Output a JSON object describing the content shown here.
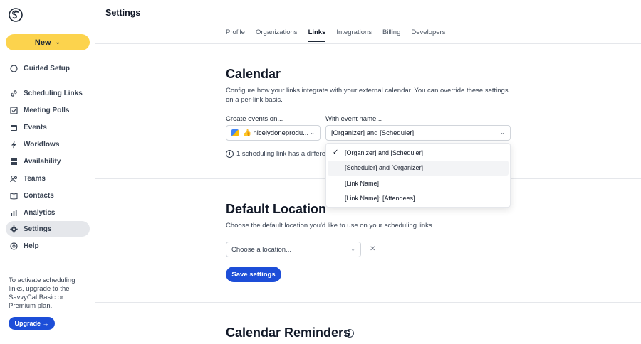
{
  "sidebar": {
    "new_label": "New",
    "items": [
      {
        "label": "Guided Setup",
        "icon": "circle-icon"
      },
      {
        "label": "Scheduling Links",
        "icon": "link-icon"
      },
      {
        "label": "Meeting Polls",
        "icon": "poll-icon"
      },
      {
        "label": "Events",
        "icon": "calendar-icon"
      },
      {
        "label": "Workflows",
        "icon": "bolt-icon"
      },
      {
        "label": "Availability",
        "icon": "grid-icon"
      },
      {
        "label": "Teams",
        "icon": "users-icon"
      },
      {
        "label": "Contacts",
        "icon": "book-icon"
      },
      {
        "label": "Analytics",
        "icon": "chart-icon"
      },
      {
        "label": "Settings",
        "icon": "gear-icon"
      },
      {
        "label": "Help",
        "icon": "help-icon"
      }
    ],
    "promo_text": "To activate scheduling links, upgrade to the SavvyCal Basic or Premium plan.",
    "upgrade_label": "Upgrade →"
  },
  "header": {
    "title": "Settings",
    "tabs": [
      {
        "label": "Profile"
      },
      {
        "label": "Organizations"
      },
      {
        "label": "Links"
      },
      {
        "label": "Integrations"
      },
      {
        "label": "Billing"
      },
      {
        "label": "Developers"
      }
    ]
  },
  "calendar_section": {
    "title": "Calendar",
    "description": "Configure how your links integrate with your external calendar. You can override these settings on a per-link basis.",
    "create_events_label": "Create events on...",
    "create_events_value": "👍 nicelydoneprodu...",
    "event_name_label": "With event name...",
    "event_name_value": "[Organizer] and [Scheduler]",
    "info_text": "1 scheduling link has a different",
    "dropdown_options": [
      {
        "label": "[Organizer] and [Scheduler]",
        "selected": true
      },
      {
        "label": "[Scheduler] and [Organizer]",
        "selected": false
      },
      {
        "label": "[Link Name]",
        "selected": false
      },
      {
        "label": "[Link Name]: [Attendees]",
        "selected": false
      }
    ]
  },
  "location_section": {
    "title": "Default Location",
    "description": "Choose the default location you'd like to use on your scheduling links.",
    "select_placeholder": "Choose a location...",
    "save_label": "Save settings"
  },
  "reminders_section": {
    "title": "Calendar Reminders"
  }
}
